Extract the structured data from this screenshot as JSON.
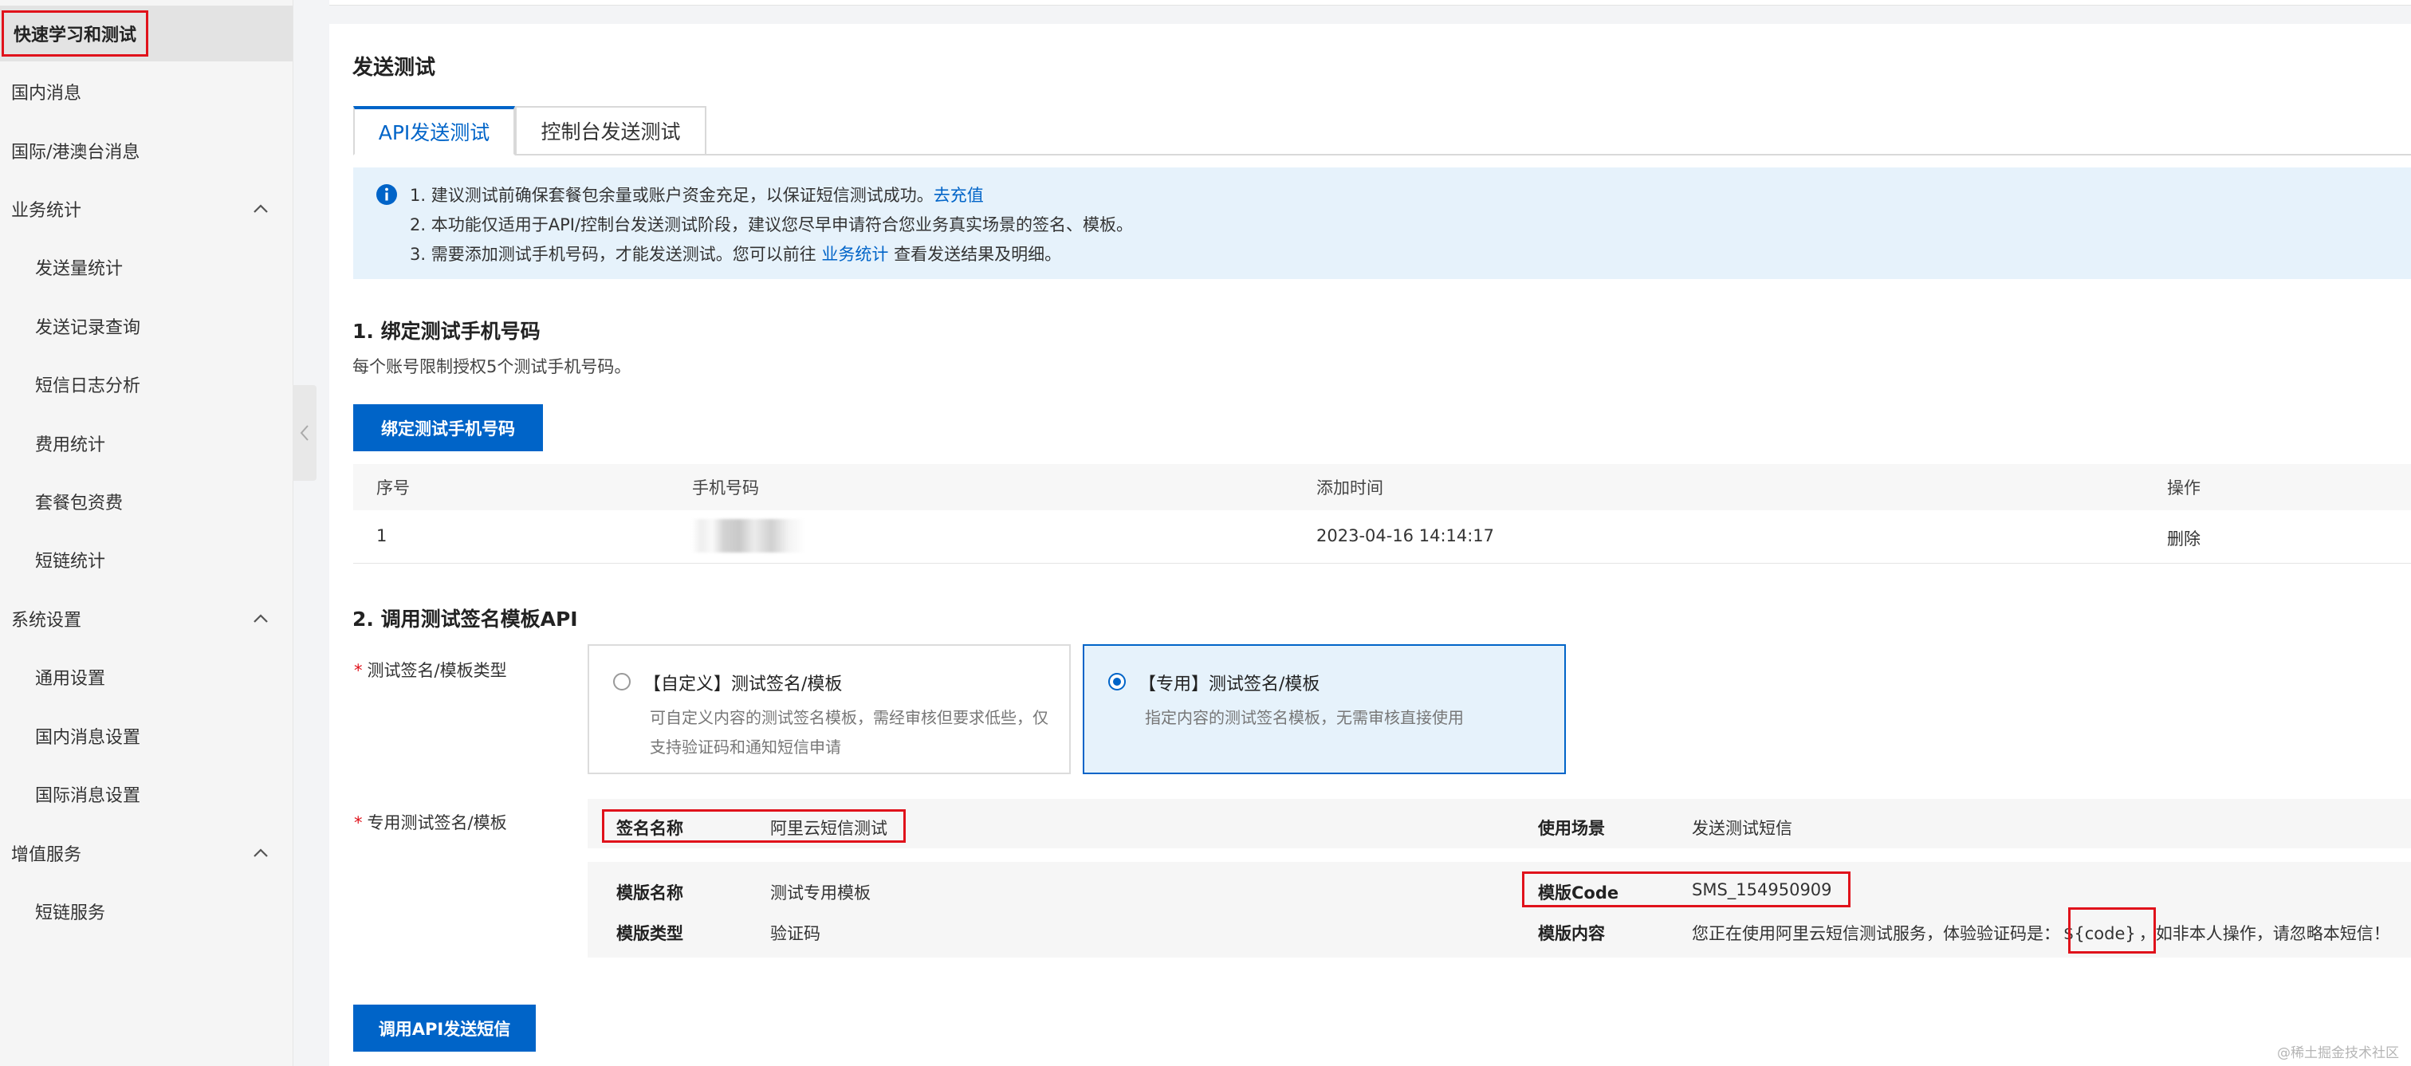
{
  "sidebar": {
    "items": [
      {
        "label": "快速学习和测试"
      },
      {
        "label": "国内消息"
      },
      {
        "label": "国际/港澳台消息"
      },
      {
        "label": "业务统计"
      },
      {
        "label": "发送量统计"
      },
      {
        "label": "发送记录查询"
      },
      {
        "label": "短信日志分析"
      },
      {
        "label": "费用统计"
      },
      {
        "label": "套餐包资费"
      },
      {
        "label": "短链统计"
      },
      {
        "label": "系统设置"
      },
      {
        "label": "通用设置"
      },
      {
        "label": "国内消息设置"
      },
      {
        "label": "国际消息设置"
      },
      {
        "label": "增值服务"
      },
      {
        "label": "短链服务"
      }
    ]
  },
  "main": {
    "title": "发送测试",
    "tabs": [
      {
        "label": "API发送测试"
      },
      {
        "label": "控制台发送测试"
      }
    ],
    "notice": {
      "line1": "1. 建议测试前确保套餐包余量或账户资金充足，以保证短信测试成功。",
      "line1_link": "去充值",
      "line2": "2. 本功能仅适用于API/控制台发送测试阶段，建议您尽早申请符合您业务真实场景的签名、模板。",
      "line3_pre": "3. 需要添加测试手机号码，才能发送测试。您可以前往 ",
      "line3_link": "业务统计",
      "line3_post": " 查看发送结果及明细。"
    },
    "section1": {
      "title": "1. 绑定测试手机号码",
      "desc": "每个账号限制授权5个测试手机号码。",
      "bind_button": "绑定测试手机号码",
      "table": {
        "headers": [
          "序号",
          "手机号码",
          "添加时间",
          "操作"
        ],
        "rows": [
          {
            "index": "1",
            "phone": "",
            "time": "2023-04-16 14:14:17",
            "action": "删除"
          }
        ]
      }
    },
    "section2": {
      "title": "2. 调用测试签名模板API",
      "type_label": "测试签名/模板类型",
      "required_mark": "*",
      "options": [
        {
          "title": "【自定义】测试签名/模板",
          "desc": "可自定义内容的测试签名模板，需经审核但要求低些，仅支持验证码和通知短信申请",
          "selected": false
        },
        {
          "title": "【专用】测试签名/模板",
          "desc": "指定内容的测试签名模板，无需审核直接使用",
          "selected": true
        }
      ],
      "dedicated_label": "专用测试签名/模板",
      "info": {
        "sign_name_key": "签名名称",
        "sign_name_val": "阿里云短信测试",
        "scene_key": "使用场景",
        "scene_val": "发送测试短信",
        "tpl_name_key": "模版名称",
        "tpl_name_val": "测试专用模板",
        "tpl_code_key": "模版Code",
        "tpl_code_val": "SMS_154950909",
        "tpl_type_key": "模版类型",
        "tpl_type_val": "验证码",
        "tpl_content_key": "模版内容",
        "tpl_content_pre": "您正在使用阿里云短信测试服务，体验验证码是：",
        "tpl_content_var": "${code}",
        "tpl_content_post": "，如非本人操作，请忽略本短信！"
      },
      "call_button": "调用API发送短信"
    }
  },
  "watermark": "@稀土掘金技术社区",
  "colors": {
    "accent": "#0064c8",
    "highlight": "#e0121b",
    "notice_bg": "#e6f2fb"
  }
}
